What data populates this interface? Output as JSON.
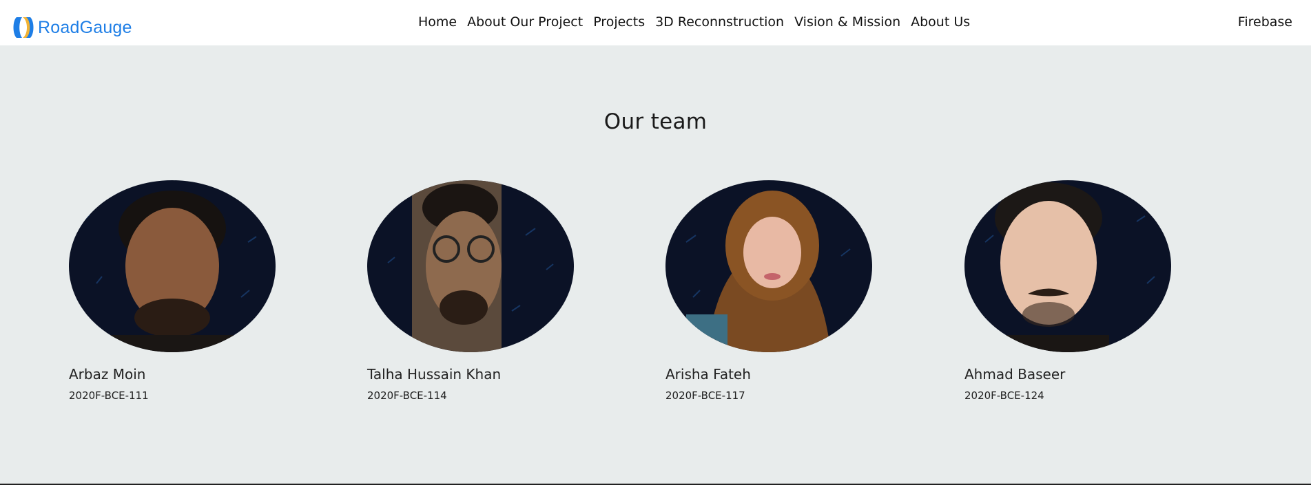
{
  "brand": {
    "name": "RoadGauge",
    "logo_icon": "roadgauge-logo-icon",
    "color": "#1e7ee6"
  },
  "nav": {
    "items": [
      {
        "label": "Home"
      },
      {
        "label": "About Our Project"
      },
      {
        "label": "Projects"
      },
      {
        "label": "3D Reconnstruction"
      },
      {
        "label": "Vision & Mission"
      },
      {
        "label": "About Us"
      }
    ],
    "right_label": "Firebase"
  },
  "team": {
    "title": "Our team",
    "members": [
      {
        "name": "Arbaz Moin",
        "id": "2020F-BCE-111"
      },
      {
        "name": "Talha Hussain Khan",
        "id": "2020F-BCE-114"
      },
      {
        "name": "Arisha Fateh",
        "id": "2020F-BCE-117"
      },
      {
        "name": "Ahmad Baseer",
        "id": "2020F-BCE-124"
      }
    ]
  },
  "colors": {
    "page_bg": "#e8ecec",
    "avatar_bg": "#0b1226"
  }
}
